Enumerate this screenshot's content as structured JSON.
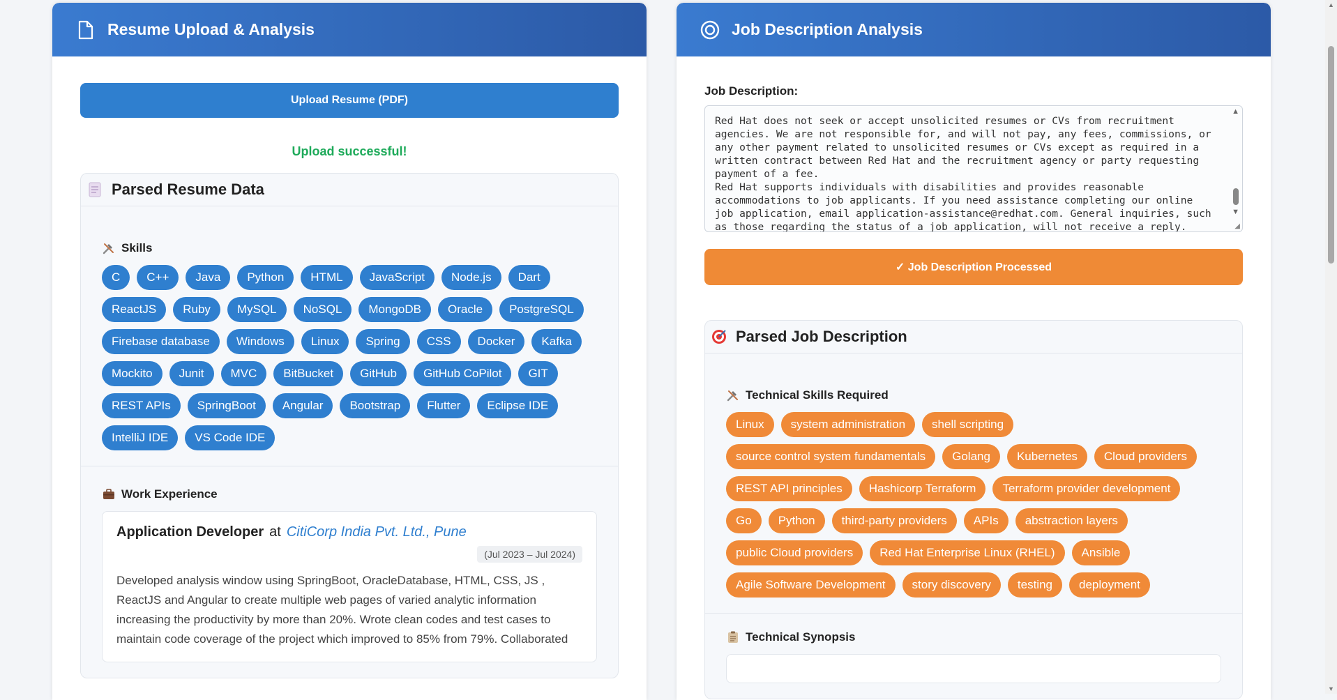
{
  "resume_panel": {
    "title": "Resume Upload & Analysis",
    "upload_button": "Upload Resume (PDF)",
    "upload_status": "Upload successful!",
    "parsed_title": "Parsed Resume Data",
    "skills_title": "Skills",
    "skills": [
      "C",
      "C++",
      "Java",
      "Python",
      "HTML",
      "JavaScript",
      "Node.js",
      "Dart",
      "ReactJS",
      "Ruby",
      "MySQL",
      "NoSQL",
      "MongoDB",
      "Oracle",
      "PostgreSQL",
      "Firebase database",
      "Windows",
      "Linux",
      "Spring",
      "CSS",
      "Docker",
      "Kafka",
      "Mockito",
      "Junit",
      "MVC",
      "BitBucket",
      "GitHub",
      "GitHub CoPilot",
      "GIT",
      "REST APIs",
      "SpringBoot",
      "Angular",
      "Bootstrap",
      "Flutter",
      "Eclipse IDE",
      "IntelliJ IDE",
      "VS Code IDE"
    ],
    "work_title": "Work Experience",
    "job": {
      "title": "Application Developer",
      "at": "at",
      "company": "CitiCorp India Pvt. Ltd., Pune",
      "dates": "(Jul 2023 – Jul 2024)",
      "description": "Developed analysis window using SpringBoot, OracleDatabase, HTML, CSS, JS , ReactJS and Angular to create multiple web pages of varied analytic information increasing the productivity by more than 20%. Wrote clean codes and test cases to maintain code coverage of the project which improved to 85% from 79%. Collaborated"
    }
  },
  "jd_panel": {
    "title": "Job Description Analysis",
    "label": "Job Description:",
    "text": "Red Hat does not seek or accept unsolicited resumes or CVs from recruitment agencies. We are not responsible for, and will not pay, any fees, commissions, or any other payment related to unsolicited resumes or CVs except as required in a written contract between Red Hat and the recruitment agency or party requesting payment of a fee.\nRed Hat supports individuals with disabilities and provides reasonable accommodations to job applicants. If you need assistance completing our online job application, email application-assistance@redhat.com. General inquiries, such as those regarding the status of a job application, will not receive a reply.",
    "processed_button": "✓ Job Description Processed",
    "parsed_title": "Parsed Job Description",
    "tech_skills_title": "Technical Skills Required",
    "tech_skills": [
      "Linux",
      "system administration",
      "shell scripting",
      "source control system fundamentals",
      "Golang",
      "Kubernetes",
      "Cloud providers",
      "REST API principles",
      "Hashicorp Terraform",
      "Terraform provider development",
      "Go",
      "Python",
      "third-party providers",
      "APIs",
      "abstraction layers",
      "public Cloud providers",
      "Red Hat Enterprise Linux (RHEL)",
      "Ansible",
      "Agile Software Development",
      "story discovery",
      "testing",
      "deployment"
    ],
    "synopsis_title": "Technical Synopsis"
  },
  "colors": {
    "header_gradient_start": "#3a7bd0",
    "header_gradient_end": "#2c5aa7",
    "skill_blue": "#2f7fcf",
    "skill_orange": "#f08a38",
    "success_green": "#1eaa5a"
  },
  "icons": {
    "resume_header": "document-icon",
    "jd_header": "target-ring-icon",
    "parsed_resume": "page-icon",
    "skills": "tools-icon",
    "work": "briefcase-icon",
    "parsed_jd": "bullseye-icon",
    "tech_skills": "tools-icon",
    "synopsis": "clipboard-icon"
  }
}
